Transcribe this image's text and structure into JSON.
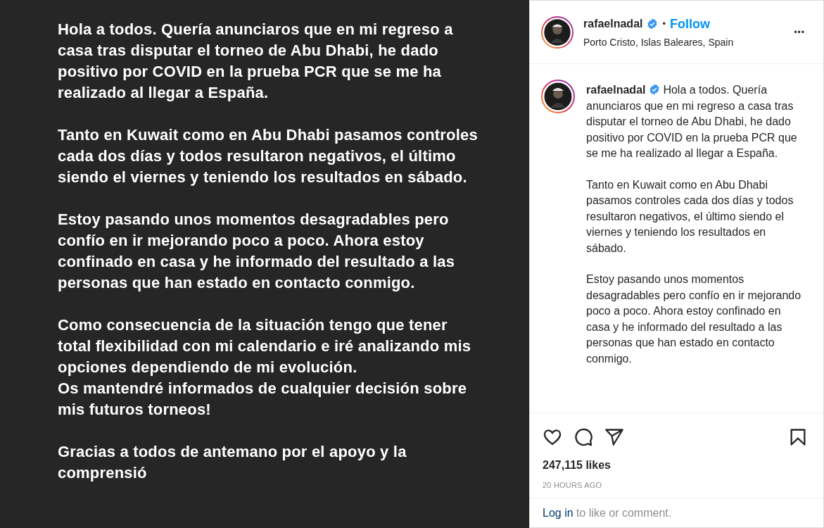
{
  "post_image": {
    "kind": "text_card",
    "paragraphs": [
      "Hola a todos. Quería anunciaros que en mi regreso a casa tras disputar el torneo de Abu Dhabi, he dado positivo por COVID en la prueba PCR que se me ha realizado al llegar a España.",
      "Tanto en Kuwait como en Abu Dhabi pasamos controles cada dos días y todos resultaron negativos, el último siendo el viernes y teniendo los resultados en sábado.",
      "Estoy pasando unos momentos desagradables pero confío en ir mejorando poco a poco. Ahora estoy confinado en casa y he informado del resultado a las personas que han estado en contacto conmigo.",
      "Como consecuencia de la situación tengo que tener total flexibilidad con mi calendario e iré analizando mis opciones dependiendo de mi evolución.\nOs mantendré informados de cualquier decisión sobre mis futuros torneos!",
      "Gracias a todos de antemano por el apoyo y la comprensió"
    ]
  },
  "header": {
    "username": "rafaelnadal",
    "verified": true,
    "separator": "•",
    "follow": "Follow",
    "location": "Porto Cristo, Islas Baleares, Spain",
    "more": "•••"
  },
  "caption": {
    "username": "rafaelnadal",
    "verified": true,
    "paragraphs": [
      "Hola a todos. Quería anunciaros que en mi regreso a casa tras disputar el torneo de Abu Dhabi, he dado positivo por COVID en la prueba PCR que se me ha realizado al llegar a España.",
      "Tanto en Kuwait como en Abu Dhabi pasamos controles cada dos días y todos resultaron negativos, el último siendo el viernes y teniendo los resultados en sábado.",
      "Estoy pasando unos momentos desagradables pero confío en ir mejorando poco a poco. Ahora estoy confinado en casa y he informado del resultado a las personas que han estado en contacto conmigo."
    ]
  },
  "actions": {
    "liked": false,
    "saved": false
  },
  "likes": "247,115 likes",
  "time": "20 HOURS AGO",
  "login": {
    "link": "Log in",
    "text": "to like or comment."
  }
}
